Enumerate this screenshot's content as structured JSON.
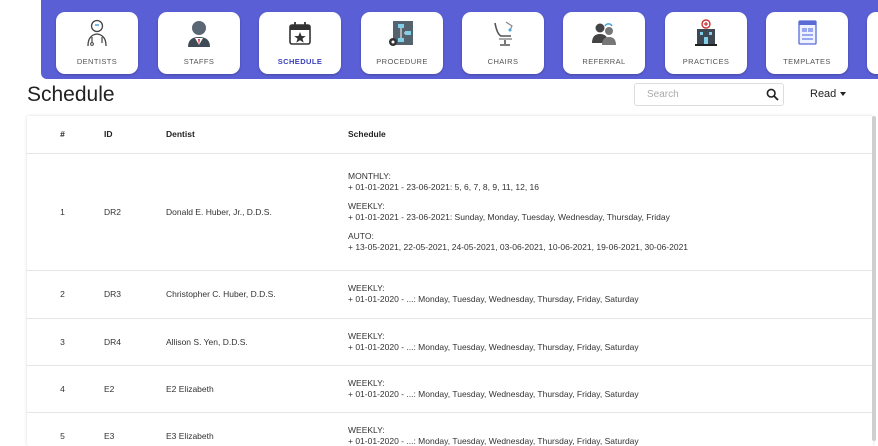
{
  "nav": {
    "tiles": [
      {
        "label": "DENTISTS",
        "icon": "dentist-icon",
        "active": false
      },
      {
        "label": "STAFFS",
        "icon": "staff-icon",
        "active": false
      },
      {
        "label": "SCHEDULE",
        "icon": "calendar-star-icon",
        "active": true
      },
      {
        "label": "PROCEDURE",
        "icon": "procedure-flow-icon",
        "active": false
      },
      {
        "label": "CHAIRS",
        "icon": "dental-chair-icon",
        "active": false
      },
      {
        "label": "REFERRAL",
        "icon": "referral-users-icon",
        "active": false
      },
      {
        "label": "PRACTICES",
        "icon": "practice-building-icon",
        "active": false
      },
      {
        "label": "TEMPLATES",
        "icon": "template-document-icon",
        "active": false
      }
    ]
  },
  "header": {
    "title": "Schedule",
    "search_placeholder": "Search",
    "mode_label": "Read"
  },
  "colors": {
    "nav_bg": "#5b5fd6",
    "active_label": "#3a3fbf"
  },
  "table": {
    "columns": [
      "#",
      "ID",
      "Dentist",
      "Schedule"
    ],
    "rows": [
      {
        "num": "1",
        "id": "DR2",
        "dentist": "Donald E. Huber, Jr.,  D.D.S.",
        "schedule": [
          {
            "type": "MONTHLY:",
            "detail": "+ 01-01-2021 - 23-06-2021:  5, 6, 7, 8, 9, 11, 12, 16"
          },
          {
            "type": "WEEKLY:",
            "detail": "+ 01-01-2021 - 23-06-2021:  Sunday, Monday, Tuesday, Wednesday, Thursday, Friday"
          },
          {
            "type": "AUTO:",
            "detail": "+ 13-05-2021, 22-05-2021, 24-05-2021, 03-06-2021, 10-06-2021, 19-06-2021, 30-06-2021"
          }
        ]
      },
      {
        "num": "2",
        "id": "DR3",
        "dentist": "Christopher C. Huber, D.D.S.",
        "schedule": [
          {
            "type": "WEEKLY:",
            "detail": "+ 01-01-2020 - ...:  Monday, Tuesday, Wednesday, Thursday, Friday, Saturday"
          }
        ]
      },
      {
        "num": "3",
        "id": "DR4",
        "dentist": "Allison S. Yen, D.D.S.",
        "schedule": [
          {
            "type": "WEEKLY:",
            "detail": "+ 01-01-2020 - ...:  Monday, Tuesday, Wednesday, Thursday, Friday, Saturday"
          }
        ]
      },
      {
        "num": "4",
        "id": "E2",
        "dentist": "E2 Elizabeth",
        "schedule": [
          {
            "type": "WEEKLY:",
            "detail": "+ 01-01-2020 - ...:  Monday, Tuesday, Wednesday, Thursday, Friday, Saturday"
          }
        ]
      },
      {
        "num": "5",
        "id": "E3",
        "dentist": "E3 Elizabeth",
        "schedule": [
          {
            "type": "WEEKLY:",
            "detail": "+ 01-01-2020 - ...:  Monday, Tuesday, Wednesday, Thursday, Friday, Saturday"
          }
        ]
      }
    ]
  }
}
